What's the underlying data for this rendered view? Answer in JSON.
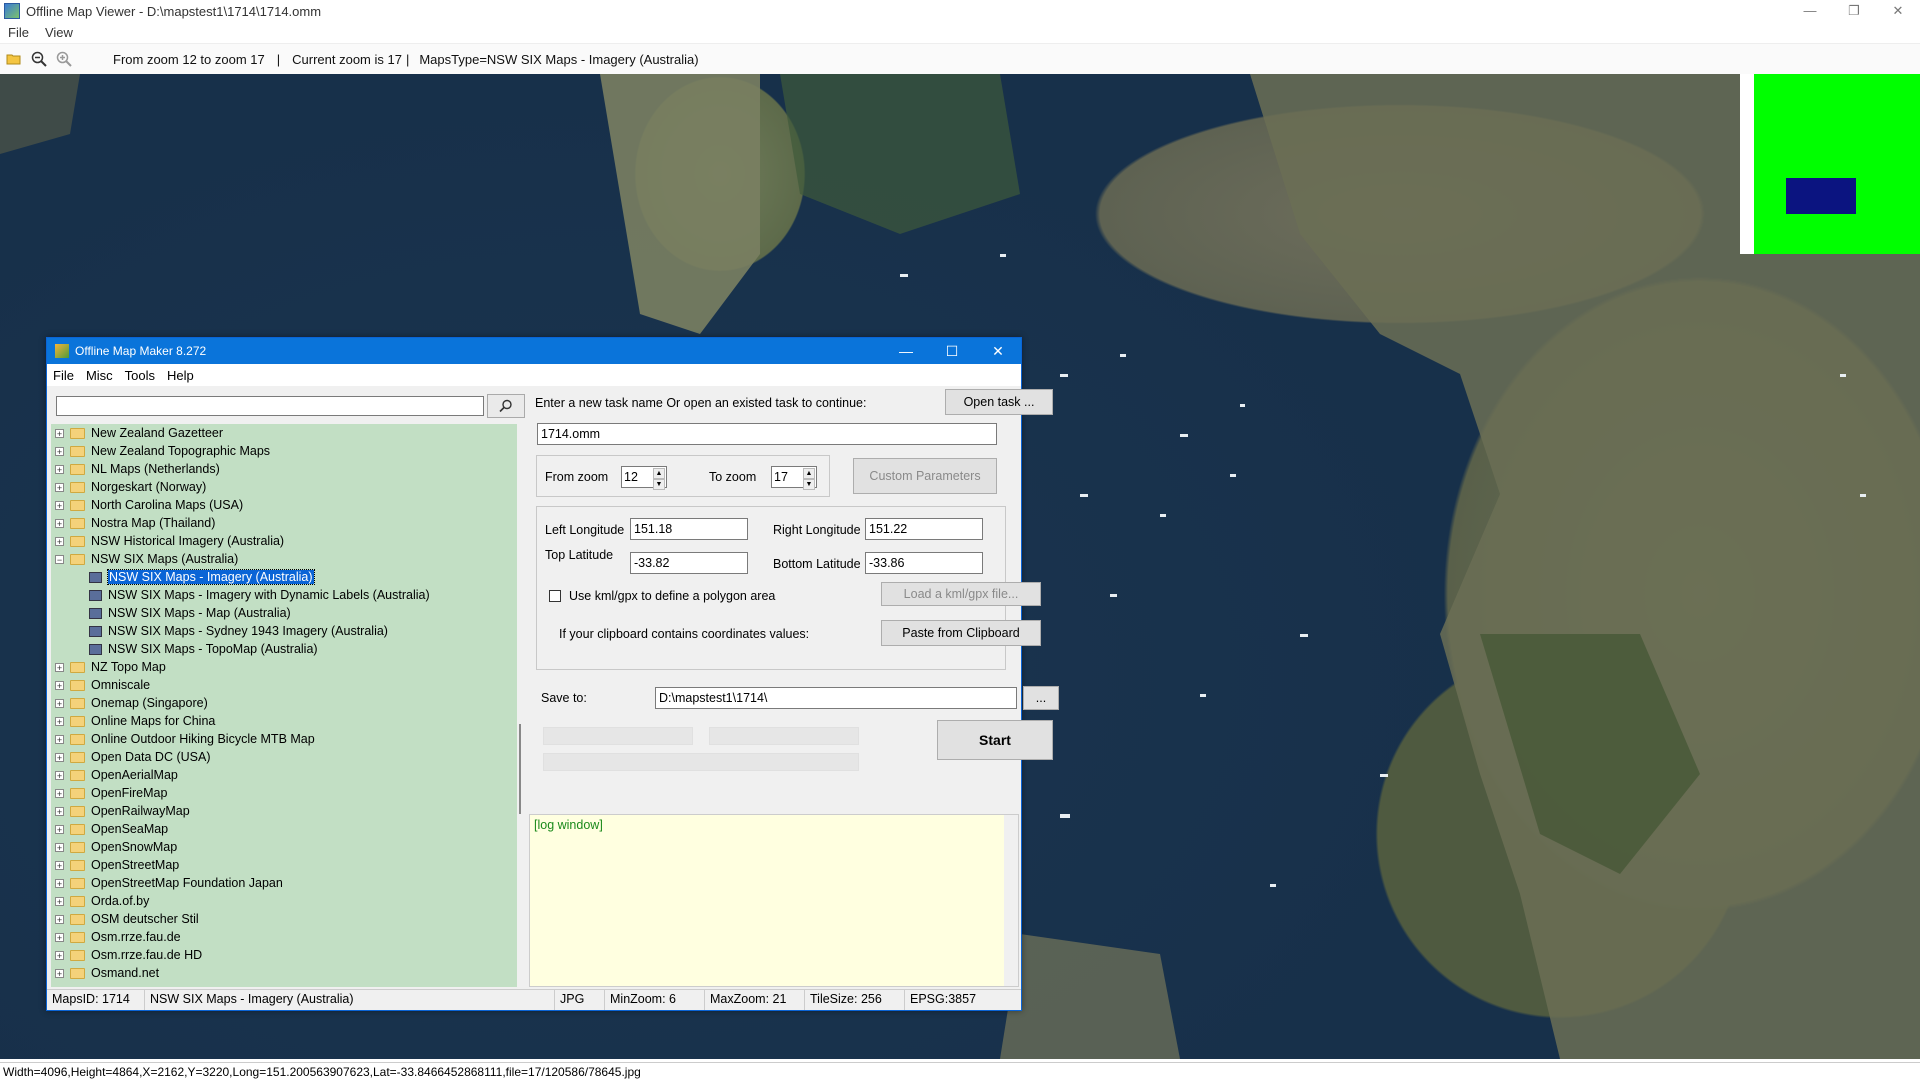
{
  "window": {
    "title": "Offline Map Viewer - D:\\mapstest1\\1714\\1714.omm",
    "controls": [
      "—",
      "❐",
      "✕"
    ]
  },
  "menu": {
    "file": "File",
    "view": "View"
  },
  "toolbar": {
    "zoom_range": "From zoom 12 to zoom 17",
    "sep1": "|",
    "current_zoom": "Current zoom is 17",
    "sep2": "|",
    "maps_type": "MapsType=NSW SIX Maps - Imagery (Australia)",
    "icons": [
      "folder-open-icon",
      "zoom-out-icon",
      "zoom-in-icon"
    ]
  },
  "statusbar": {
    "text": "Width=4096,Height=4864,X=2162,Y=3220,Long=151.200563907623,Lat=-33.8466452868111,file=17/120586/78645.jpg"
  },
  "minimap": {
    "background": "#00ff00",
    "viewport_color": "#0b1480"
  },
  "dialog": {
    "title": "Offline Map Maker 8.272",
    "controls": [
      "—",
      "☐",
      "✕"
    ],
    "menu": [
      "File",
      "Misc",
      "Tools",
      "Help"
    ],
    "search": {
      "value": "",
      "placeholder": ""
    },
    "tree": [
      {
        "label": "New Zealand Gazetteer",
        "type": "folder"
      },
      {
        "label": "New Zealand Topographic Maps",
        "type": "folder"
      },
      {
        "label": "NL Maps (Netherlands)",
        "type": "folder"
      },
      {
        "label": "Norgeskart (Norway)",
        "type": "folder"
      },
      {
        "label": "North Carolina Maps (USA)",
        "type": "folder"
      },
      {
        "label": "Nostra Map (Thailand)",
        "type": "folder"
      },
      {
        "label": "NSW Historical Imagery (Australia)",
        "type": "folder"
      },
      {
        "label": "NSW SIX Maps (Australia)",
        "type": "folder-open"
      },
      {
        "label": "NSW SIX Maps - Imagery (Australia)",
        "type": "map",
        "selected": true
      },
      {
        "label": "NSW SIX Maps - Imagery with Dynamic Labels (Australia)",
        "type": "map"
      },
      {
        "label": "NSW SIX Maps - Map (Australia)",
        "type": "map"
      },
      {
        "label": "NSW SIX Maps - Sydney 1943 Imagery (Australia)",
        "type": "map"
      },
      {
        "label": "NSW SIX Maps - TopoMap (Australia)",
        "type": "map"
      },
      {
        "label": "NZ Topo Map",
        "type": "folder"
      },
      {
        "label": "Omniscale",
        "type": "folder"
      },
      {
        "label": "Onemap (Singapore)",
        "type": "folder"
      },
      {
        "label": "Online Maps for China",
        "type": "folder"
      },
      {
        "label": "Online Outdoor Hiking Bicycle MTB Map",
        "type": "folder"
      },
      {
        "label": "Open Data DC (USA)",
        "type": "folder"
      },
      {
        "label": "OpenAerialMap",
        "type": "folder"
      },
      {
        "label": "OpenFireMap",
        "type": "folder"
      },
      {
        "label": "OpenRailwayMap",
        "type": "folder"
      },
      {
        "label": "OpenSeaMap",
        "type": "folder"
      },
      {
        "label": "OpenSnowMap",
        "type": "folder"
      },
      {
        "label": "OpenStreetMap",
        "type": "folder"
      },
      {
        "label": "OpenStreetMap Foundation Japan",
        "type": "folder"
      },
      {
        "label": "Orda.of.by",
        "type": "folder"
      },
      {
        "label": "OSM deutscher Stil",
        "type": "folder"
      },
      {
        "label": "Osm.rrze.fau.de",
        "type": "folder"
      },
      {
        "label": "Osm.rrze.fau.de HD",
        "type": "folder"
      },
      {
        "label": "Osmand.net",
        "type": "folder"
      }
    ],
    "task_prompt": "Enter a new task name Or open an existed task to continue:",
    "open_task": "Open task ...",
    "task_name": "1714.omm",
    "from_zoom_label": "From zoom",
    "from_zoom": "12",
    "to_zoom_label": "To zoom",
    "to_zoom": "17",
    "custom_params": "Custom Parameters",
    "left_lon_label": "Left Longitude",
    "left_lon": "151.18",
    "right_lon_label": "Right Longitude",
    "right_lon": "151.22",
    "top_lat_label": "Top Latitude",
    "top_lat": "-33.82",
    "bottom_lat_label": "Bottom Latitude",
    "bottom_lat": "-33.86",
    "kml_label": "Use kml/gpx to define a polygon area",
    "load_kml": "Load a kml/gpx file...",
    "clipboard_label": "If your clipboard contains coordinates values:",
    "paste_clipboard": "Paste from Clipboard",
    "save_to_label": "Save to:",
    "save_to": "D:\\mapstest1\\1714\\",
    "browse": "...",
    "start": "Start",
    "log": "[log window]",
    "status": {
      "maps_id": "MapsID: 1714",
      "maps_name": "NSW SIX Maps - Imagery (Australia)",
      "format": "JPG",
      "min_zoom": "MinZoom: 6",
      "max_zoom": "MaxZoom: 21",
      "tile_size": "TileSize: 256",
      "epsg": "EPSG:3857"
    }
  }
}
